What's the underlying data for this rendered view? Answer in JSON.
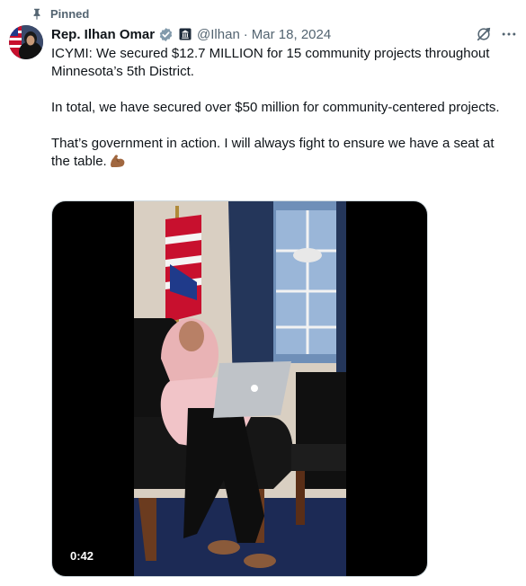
{
  "pinned": {
    "label": "Pinned"
  },
  "author": {
    "display_name": "Rep. Ilhan Omar",
    "handle": "@Ilhan",
    "separator": "·",
    "date": "Mar 18, 2024"
  },
  "icons": {
    "pin": "pin-icon",
    "verified": "verified-icon",
    "government_badge": "gov-badge-icon",
    "grok": "grok-icon",
    "more": "more-icon",
    "emoji": "flexed-biceps-icon"
  },
  "tweet": {
    "paragraphs": [
      "ICYMI: We secured $12.7 MILLION for 15 community projects throughout Minnesota’s 5th District.",
      "In total, we have secured over $50 million for community-centered projects.",
      "That’s government in action. I will always fight to ensure we have a seat at the table."
    ]
  },
  "media": {
    "type": "video",
    "duration": "0:42"
  },
  "colors": {
    "text_primary": "#0f1419",
    "text_secondary": "#536471",
    "verified": "#829aab",
    "background": "#ffffff"
  }
}
